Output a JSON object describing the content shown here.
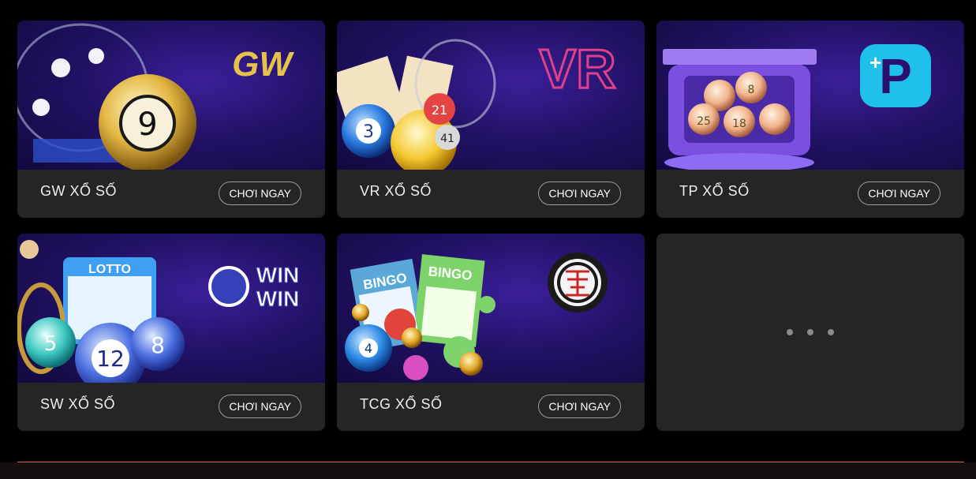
{
  "cards": [
    {
      "title": "GW XỔ SỐ",
      "button": "CHƠI NGAY",
      "logo": "GW"
    },
    {
      "title": "VR XỔ SỐ",
      "button": "CHƠI NGAY",
      "logo": "VR"
    },
    {
      "title": "TP XỔ SỐ",
      "button": "CHƠI NGAY",
      "logo": "P"
    },
    {
      "title": "SW XỔ SỐ",
      "button": "CHƠI NGAY",
      "logo_top": "WIN",
      "logo_bottom": "WIN",
      "lotto": "LOTTO"
    },
    {
      "title": "TCG XỔ SỐ",
      "button": "CHƠI NGAY",
      "bingo": "BINGO"
    }
  ],
  "more_icon": "more-dots-icon",
  "colors": {
    "card_bg": "#262526",
    "accent_line": "#d1653a",
    "banner": "#221266"
  }
}
